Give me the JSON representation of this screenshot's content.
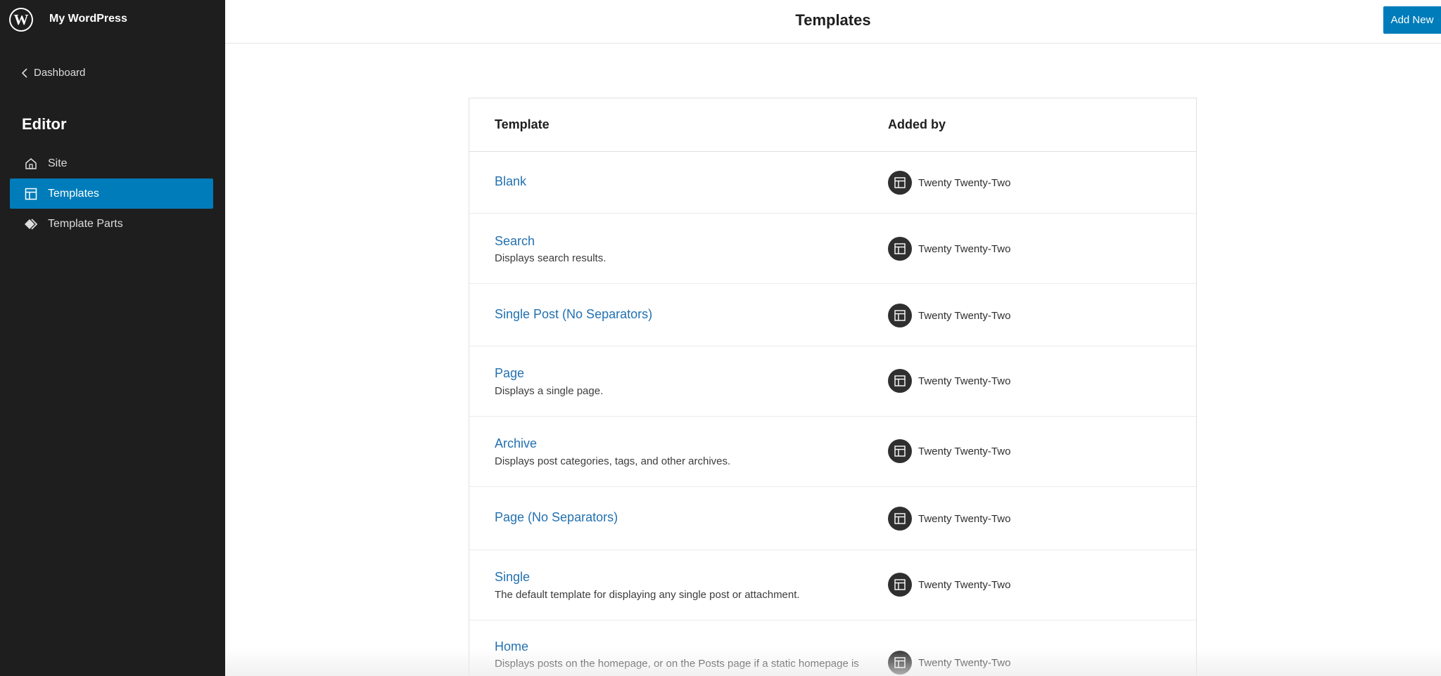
{
  "site": {
    "name": "My WordPress",
    "logo_icon": "wordpress-logo-icon"
  },
  "sidebar": {
    "back_label": "Dashboard",
    "section_title": "Editor",
    "items": [
      {
        "label": "Site",
        "icon": "home-icon",
        "active": false
      },
      {
        "label": "Templates",
        "icon": "layout-icon",
        "active": true
      },
      {
        "label": "Template Parts",
        "icon": "symbol-filled-icon",
        "active": false
      }
    ]
  },
  "header": {
    "title": "Templates",
    "add_new_label": "Add New"
  },
  "table": {
    "columns": [
      "Template",
      "Added by"
    ],
    "rows": [
      {
        "title": "Blank",
        "description": "",
        "added_by": "Twenty Twenty-Two"
      },
      {
        "title": "Search",
        "description": "Displays search results.",
        "added_by": "Twenty Twenty-Two"
      },
      {
        "title": "Single Post (No Separators)",
        "description": "",
        "added_by": "Twenty Twenty-Two"
      },
      {
        "title": "Page",
        "description": "Displays a single page.",
        "added_by": "Twenty Twenty-Two"
      },
      {
        "title": "Archive",
        "description": "Displays post categories, tags, and other archives.",
        "added_by": "Twenty Twenty-Two"
      },
      {
        "title": "Page (No Separators)",
        "description": "",
        "added_by": "Twenty Twenty-Two"
      },
      {
        "title": "Single",
        "description": "The default template for displaying any single post or attachment.",
        "added_by": "Twenty Twenty-Two"
      },
      {
        "title": "Home",
        "description": "Displays posts on the homepage, or on the Posts page if a static homepage is",
        "added_by": "Twenty Twenty-Two"
      }
    ]
  },
  "colors": {
    "sidebar_bg": "#1e1e1e",
    "accent": "#007cba",
    "link": "#2271b1"
  }
}
